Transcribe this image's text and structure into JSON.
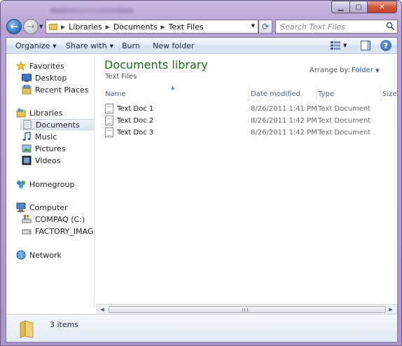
{
  "window": {
    "controls": [
      "minimize",
      "maximize",
      "close"
    ]
  },
  "address_bar": {
    "breadcrumbs": [
      "Libraries",
      "Documents",
      "Text Files"
    ]
  },
  "search": {
    "placeholder": "Search Text Files"
  },
  "toolbar": {
    "organize": "Organize",
    "share_with": "Share with",
    "burn": "Burn",
    "new_folder": "New folder"
  },
  "nav": {
    "favorites": "Favorites",
    "desktop": "Desktop",
    "recent_places": "Recent Places",
    "libraries": "Libraries",
    "documents": "Documents",
    "music": "Music",
    "pictures": "Pictures",
    "videos": "Videos",
    "homegroup": "Homegroup",
    "computer": "Computer",
    "compaq": "COMPAQ (C:)",
    "factory_image": "FACTORY_IMAGE (D",
    "network": "Network"
  },
  "library": {
    "title": "Documents library",
    "subtitle": "Text Files",
    "arrange_by_label": "Arrange by:",
    "arrange_by_value": "Folder"
  },
  "columns": {
    "name": "Name",
    "date_modified": "Date modified",
    "type": "Type",
    "size": "Size"
  },
  "files": [
    {
      "name": "Text Doc 1",
      "date": "8/26/2011 1:41 PM",
      "type": "Text Document"
    },
    {
      "name": "Text Doc 2",
      "date": "8/26/2011 1:42 PM",
      "type": "Text Document"
    },
    {
      "name": "Text Doc 3",
      "date": "8/26/2011 1:42 PM",
      "type": "Text Document"
    }
  ],
  "details": {
    "item_count": "3 items"
  },
  "colors": {
    "library_title": "#1e6a1e",
    "window_frame": "#b7a3d3",
    "link_blue": "#1e5bb0"
  }
}
